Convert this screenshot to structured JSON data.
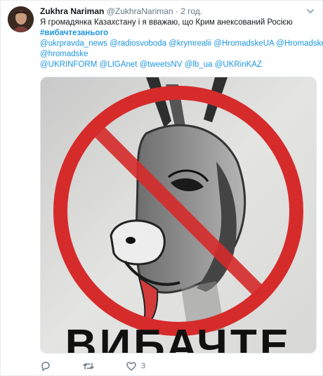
{
  "tweet": {
    "author": {
      "name": "Zukhra Nariman",
      "handle": "@ZukhraNariman",
      "separator": "·",
      "time": "2 год."
    },
    "lines": [
      "Я громадянка Казахстану і я вважаю, що Крим анексований Росією"
    ],
    "hashtag": "#вибачтезанього",
    "mentions": [
      [
        "@ukrpravda_news",
        "@radiosvoboda",
        "@krymrealii",
        "@HromadskeUA",
        "@HromadskeRU"
      ],
      [
        "@hromadske"
      ],
      [
        "@UKRINFORM",
        "@LIGAnet",
        "@tweetsNV",
        "@lb_ua",
        "@UKRinKAZ"
      ]
    ],
    "image_text": "ВИБАЧТЕ",
    "actions": {
      "reply_icon": "reply-icon",
      "retweet_icon": "retweet-icon",
      "like_icon": "heart-icon",
      "like_count": "3"
    }
  },
  "colors": {
    "link": "#1b95e0",
    "text": "#14171a",
    "muted": "#657786",
    "prohibition_red": "#d62b2b"
  }
}
